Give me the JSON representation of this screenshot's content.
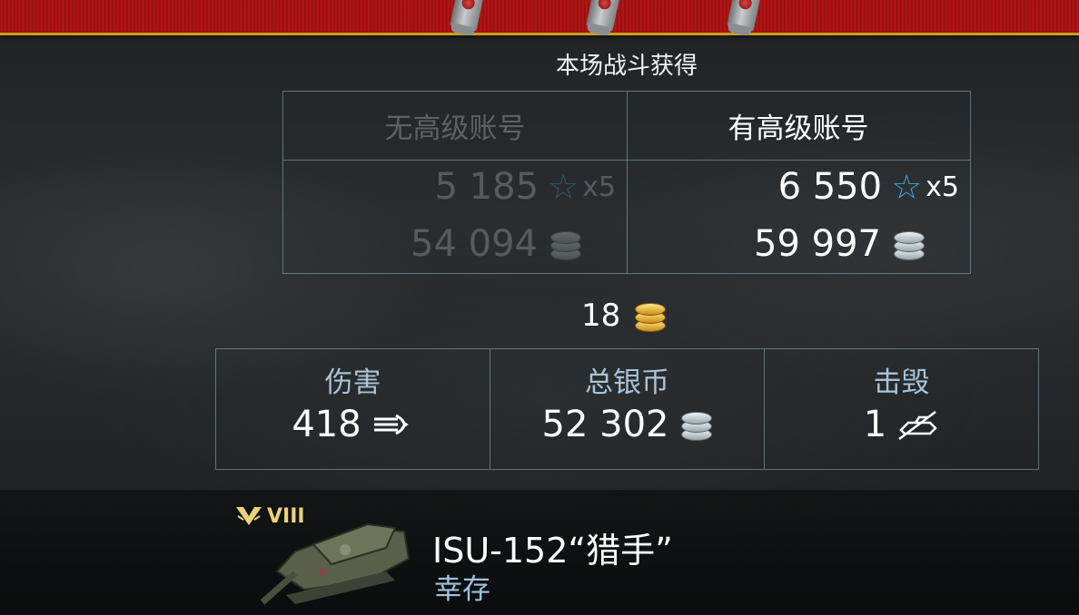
{
  "heading": "本场战斗获得",
  "earnings": {
    "no_premium": {
      "label": "无高级账号",
      "xp": "5 185",
      "xp_multiplier": "x5",
      "silver": "54 094"
    },
    "premium": {
      "label": "有高级账号",
      "xp": "6 550",
      "xp_multiplier": "x5",
      "silver": "59 997"
    }
  },
  "gold": "18",
  "stats": [
    {
      "label": "伤害",
      "value": "418",
      "icon": "shell-damage-icon"
    },
    {
      "label": "总银币",
      "value": "52 302",
      "icon": "silver-coins-icon"
    },
    {
      "label": "击毁",
      "value": "1",
      "icon": "destroyed-tank-icon"
    }
  ],
  "tank": {
    "tier": "VIII",
    "name": "ISU-152“猎手”",
    "status": "幸存"
  },
  "icons": {
    "xp": "star-icon",
    "silver": "silver-coins-icon",
    "gold": "gold-coins-icon",
    "tier_badge": "mastery-badge-icon"
  },
  "colors": {
    "banner_red": "#b81818",
    "banner_gold": "#c8a020",
    "xp_star_blue": "#3fa0d8",
    "label_blue": "#a9c3d6",
    "tier_gold": "#e9d27a"
  }
}
